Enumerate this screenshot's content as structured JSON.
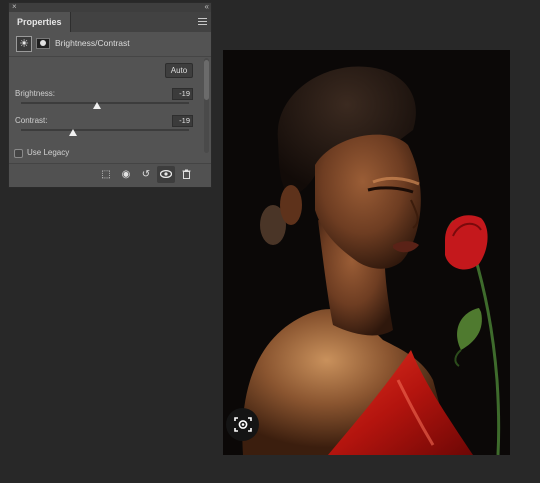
{
  "panel": {
    "close_glyph": "×",
    "collapse_glyph": "«",
    "tab_label": "Properties",
    "menu_icon": "hamburger-menu-icon",
    "adjustment_icon": "brightness-contrast-icon",
    "mask_icon": "layer-mask-icon",
    "adjustment_title": "Brightness/Contrast",
    "auto_label": "Auto",
    "brightness": {
      "label": "Brightness:",
      "value": "-19",
      "level": 0.45
    },
    "contrast": {
      "label": "Contrast:",
      "value": "-19",
      "level": 0.31
    },
    "legacy": {
      "label": "Use Legacy",
      "checked": false
    },
    "footer_buttons": [
      {
        "name": "clip-to-layer-icon",
        "glyph": "⬚"
      },
      {
        "name": "view-previous-state-icon",
        "glyph": "◉"
      },
      {
        "name": "reset-adjustments-icon",
        "glyph": "↺"
      },
      {
        "name": "toggle-visibility-icon",
        "glyph": "👁"
      },
      {
        "name": "delete-icon",
        "glyph": "🗑"
      }
    ]
  },
  "canvas": {
    "image_subject": "woman-with-red-rose-photo",
    "lens_icon": "visual-search-lens-icon"
  }
}
